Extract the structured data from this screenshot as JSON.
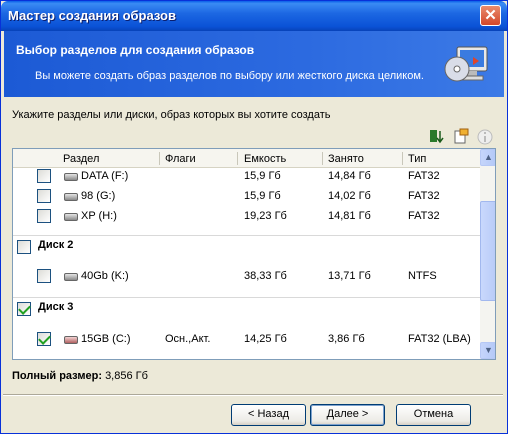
{
  "window": {
    "title": "Мастер создания образов"
  },
  "header": {
    "title": "Выбор разделов для создания образов",
    "subtitle": "Вы можете создать образ разделов по выбору или жесткого диска целиком.",
    "icon": "monitor-disk-icon"
  },
  "instruction": "Укажите разделы или диски, образ которых вы хотите создать",
  "toolbar": {
    "icons": [
      "sort-down-icon",
      "properties-icon",
      "info-icon"
    ]
  },
  "table": {
    "columns": [
      "Раздел",
      "Флаги",
      "Емкость",
      "Занято",
      "Тип"
    ],
    "rows_top": [
      {
        "name": "DATA (F:)",
        "flags": "",
        "capacity": "15,9 Гб",
        "used": "14,84 Гб",
        "type": "FAT32",
        "checked": false
      },
      {
        "name": "98 (G:)",
        "flags": "",
        "capacity": "15,9 Гб",
        "used": "14,02 Гб",
        "type": "FAT32",
        "checked": false
      },
      {
        "name": "XP (H:)",
        "flags": "",
        "capacity": "19,23 Гб",
        "used": "14,81 Гб",
        "type": "FAT32",
        "checked": false
      }
    ],
    "disk2": {
      "label": "Диск 2",
      "checked": false
    },
    "rows_disk2": [
      {
        "name": "40Gb (K:)",
        "flags": "",
        "capacity": "38,33 Гб",
        "used": "13,71 Гб",
        "type": "NTFS",
        "checked": false
      }
    ],
    "disk3": {
      "label": "Диск 3",
      "checked": true
    },
    "rows_disk3": [
      {
        "name": "15GB (C:)",
        "flags": "Осн.,Акт.",
        "capacity": "14,25 Гб",
        "used": "3,86 Гб",
        "type": "FAT32 (LBA)",
        "checked": true
      }
    ]
  },
  "total": {
    "label": "Полный размер:",
    "value": "3,856 Гб"
  },
  "buttons": {
    "back": "< Назад",
    "next": "Далее >",
    "cancel": "Отмена"
  },
  "colors": {
    "title_bar": "#0a52d6",
    "header_bg": "#1c5ad5",
    "check_green": "#21a121",
    "dialog_bg": "#ece9d8"
  }
}
